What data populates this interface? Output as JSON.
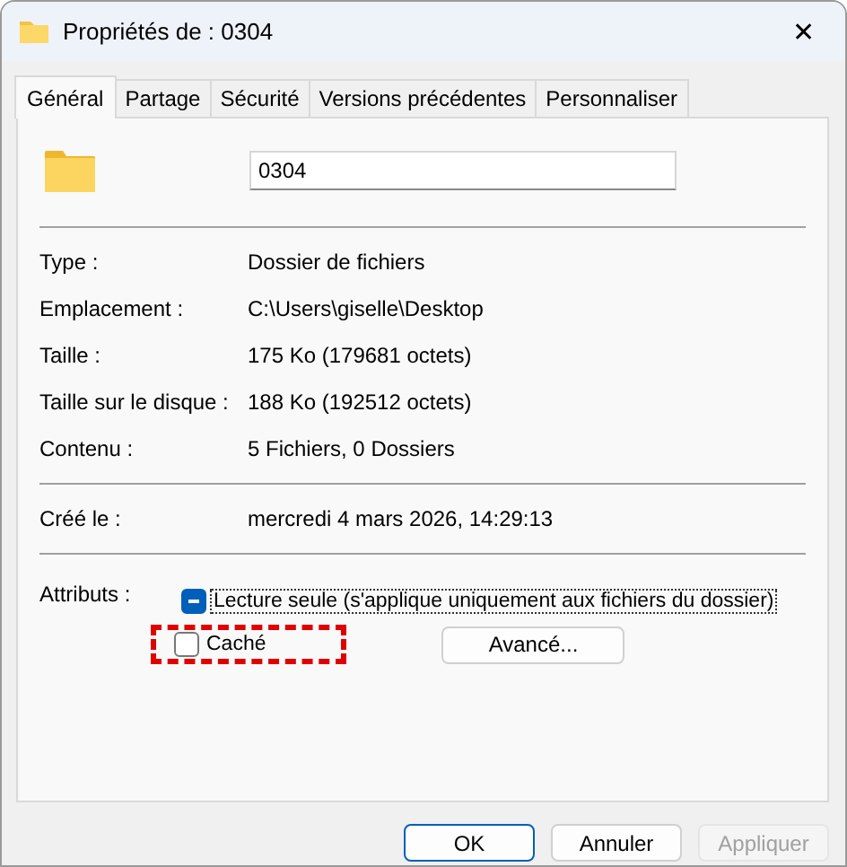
{
  "window": {
    "title": "Propriétés de : 0304",
    "close": "✕"
  },
  "tabs": [
    {
      "label": "Général",
      "selected": true
    },
    {
      "label": "Partage",
      "selected": false
    },
    {
      "label": "Sécurité",
      "selected": false
    },
    {
      "label": "Versions précédentes",
      "selected": false
    },
    {
      "label": "Personnaliser",
      "selected": false
    }
  ],
  "name_field": {
    "value": "0304"
  },
  "groups": [
    [
      {
        "label": "Type :",
        "value": "Dossier de fichiers"
      },
      {
        "label": "Emplacement :",
        "value": "C:\\Users\\giselle\\Desktop"
      },
      {
        "label": "Taille :",
        "value": "175 Ko (179681 octets)"
      },
      {
        "label": "Taille sur le disque :",
        "value": "188 Ko (192512 octets)"
      },
      {
        "label": "Contenu :",
        "value": "5 Fichiers, 0 Dossiers"
      }
    ],
    [
      {
        "label": "Créé le :",
        "value": "mercredi 4 mars 2026, 14:29:13"
      }
    ]
  ],
  "attributes": {
    "label": "Attributs :",
    "items": [
      {
        "label": "Lecture seule (s'applique uniquement aux fichiers du dossier)",
        "mixed": true,
        "focused": true,
        "highlighted": false
      },
      {
        "label": "Caché",
        "checked": false,
        "mixed": false,
        "focused": false,
        "highlighted": true
      }
    ],
    "advanced_button": "Avancé..."
  },
  "buttons": [
    {
      "label": "OK",
      "kind": "default"
    },
    {
      "label": "Annuler",
      "kind": "normal"
    },
    {
      "label": "Appliquer",
      "kind": "disabled"
    }
  ]
}
